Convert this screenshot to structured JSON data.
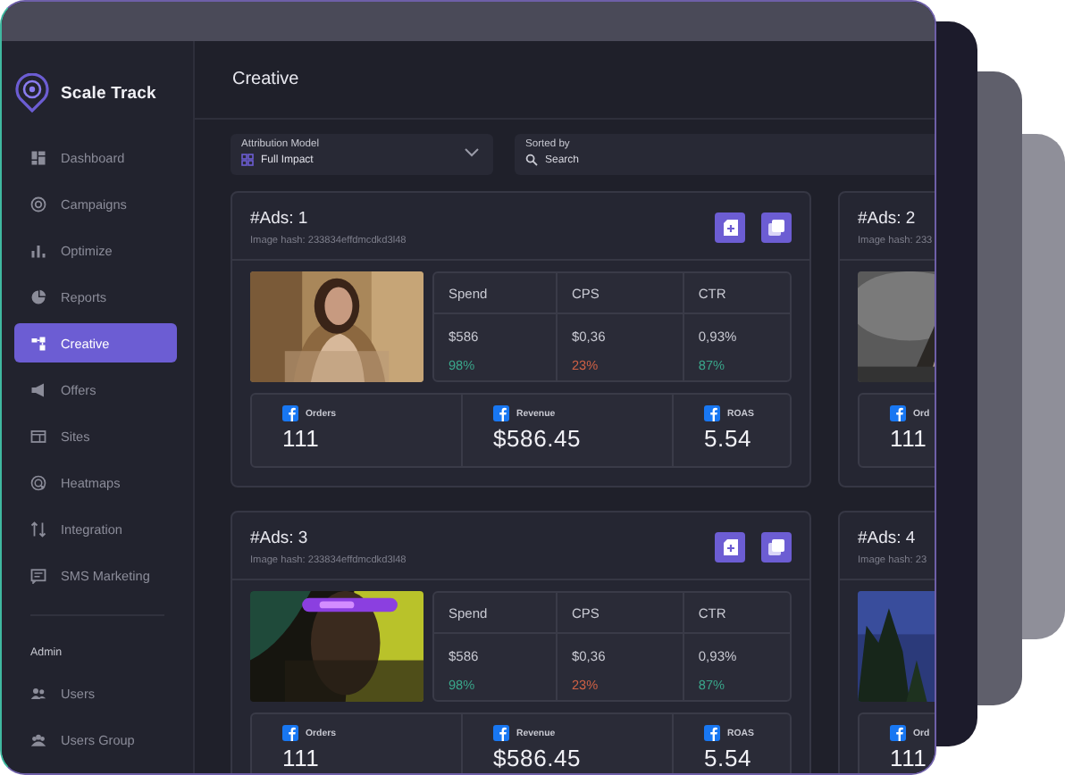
{
  "window": {
    "brand": "Scale Track"
  },
  "sidebar": {
    "items": [
      {
        "label": "Dashboard",
        "selected": false
      },
      {
        "label": "Campaigns",
        "selected": false
      },
      {
        "label": "Optimize",
        "selected": false
      },
      {
        "label": "Reports",
        "selected": false
      },
      {
        "label": "Creative",
        "selected": true
      },
      {
        "label": "Offers",
        "selected": false
      },
      {
        "label": "Sites",
        "selected": false
      },
      {
        "label": "Heatmaps",
        "selected": false
      },
      {
        "label": "Integration",
        "selected": false
      },
      {
        "label": "SMS Marketing",
        "selected": false
      }
    ],
    "section": "Admin",
    "admin_items": [
      {
        "label": "Users",
        "selected": false
      },
      {
        "label": "Users Group",
        "selected": false
      }
    ]
  },
  "page": {
    "title": "Creative",
    "filters": [
      {
        "kind": "select",
        "label": "Attribution Model",
        "value": "Full Impact"
      },
      {
        "kind": "search",
        "label": "Sorted by",
        "placeholder": "Search"
      }
    ]
  },
  "ads": [
    {
      "title": "#Ads: 1",
      "hash": "Image hash: 233834effdmcdkd3l48",
      "actions": [
        {
          "kind": "add"
        },
        {
          "kind": "copy"
        }
      ],
      "metrics": [
        {
          "name": "Spend",
          "value": "$586",
          "change": "98%",
          "color": "#3aa58a"
        },
        {
          "name": "CPS",
          "value": "$0,36",
          "change": "23%",
          "color": "#cf6145"
        },
        {
          "name": "CTR",
          "value": "0,93%",
          "change": "87%",
          "color": "#3aa58a"
        }
      ],
      "stats": [
        {
          "label": "Orders",
          "value": "111"
        },
        {
          "label": "Revenue",
          "value": "$586.45"
        },
        {
          "label": "ROAS",
          "value": "5.54"
        }
      ]
    },
    {
      "title": "#Ads: 2",
      "hash": "Image hash: 233",
      "stats": [
        {
          "label": "Ord",
          "value": "111"
        }
      ]
    },
    {
      "title": "#Ads: 3",
      "hash": "Image hash: 233834effdmcdkd3l48",
      "actions": [
        {
          "kind": "add"
        },
        {
          "kind": "copy"
        }
      ],
      "metrics": [
        {
          "name": "Spend",
          "value": "$586",
          "change": "98%",
          "color": "#3aa58a"
        },
        {
          "name": "CPS",
          "value": "$0,36",
          "change": "23%",
          "color": "#cf6145"
        },
        {
          "name": "CTR",
          "value": "0,93%",
          "change": "87%",
          "color": "#3aa58a"
        }
      ],
      "stats": [
        {
          "label": "Orders",
          "value": "111"
        },
        {
          "label": "Revenue",
          "value": "$586.45"
        },
        {
          "label": "ROAS",
          "value": "5.54"
        }
      ]
    },
    {
      "title": "#Ads: 4",
      "hash": "Image hash: 23",
      "stats": [
        {
          "label": "Ord",
          "value": "111"
        }
      ]
    }
  ]
}
